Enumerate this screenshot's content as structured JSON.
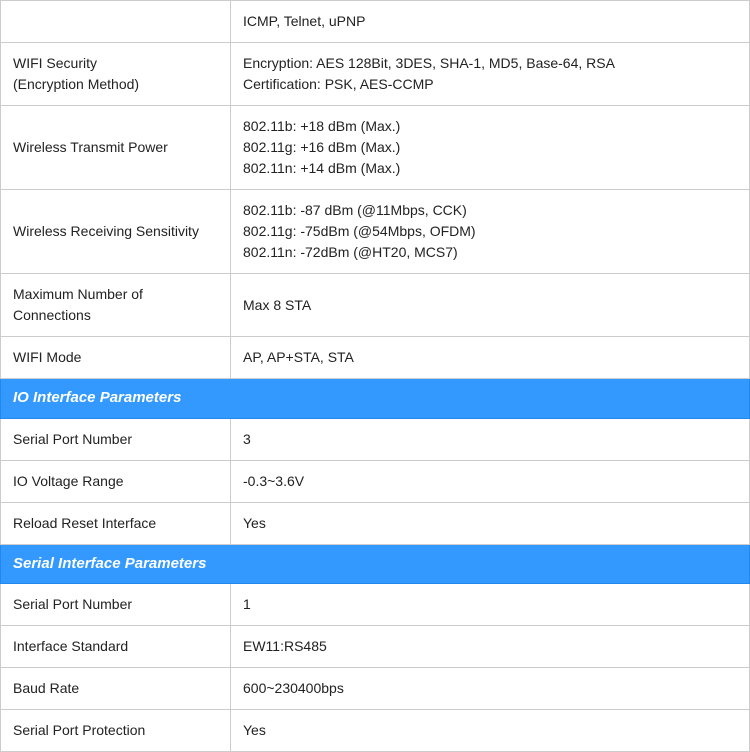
{
  "table": {
    "rows": [
      {
        "type": "data",
        "label": "WIFI Security\n(Encryption Method)",
        "value": "Encryption: AES 128Bit, 3DES, SHA-1, MD5, Base-64, RSA\nCertification: PSK, AES-CCMP"
      },
      {
        "type": "data",
        "label": "Wireless Transmit Power",
        "value": "802.11b: +18 dBm (Max.)\n802.11g: +16 dBm (Max.)\n802.11n: +14 dBm (Max.)"
      },
      {
        "type": "data",
        "label": "Wireless Receiving Sensitivity",
        "value": "802.11b: -87 dBm (@11Mbps, CCK)\n802.11g: -75dBm (@54Mbps, OFDM)\n802.11n: -72dBm (@HT20, MCS7)"
      },
      {
        "type": "data",
        "label": "Maximum Number of Connections",
        "value": "Max 8 STA"
      },
      {
        "type": "data",
        "label": "WIFI Mode",
        "value": "AP, AP+STA, STA"
      },
      {
        "type": "section",
        "label": "IO Interface Parameters"
      },
      {
        "type": "data",
        "label": "Serial Port Number",
        "value": "3"
      },
      {
        "type": "data",
        "label": "IO Voltage Range",
        "value": "-0.3~3.6V"
      },
      {
        "type": "data",
        "label": "Reload Reset Interface",
        "value": "Yes"
      },
      {
        "type": "section",
        "label": "Serial Interface Parameters"
      },
      {
        "type": "data",
        "label": "Serial Port Number",
        "value": "1"
      },
      {
        "type": "data",
        "label": "Interface Standard",
        "value": "EW11:RS485"
      },
      {
        "type": "data",
        "label": "Baud Rate",
        "value": "600~230400bps"
      },
      {
        "type": "data",
        "label": "Serial Port Protection",
        "value": "Yes"
      }
    ],
    "top_partial_row": {
      "label": "",
      "value": "ICMP, Telnet, uPNP"
    }
  }
}
